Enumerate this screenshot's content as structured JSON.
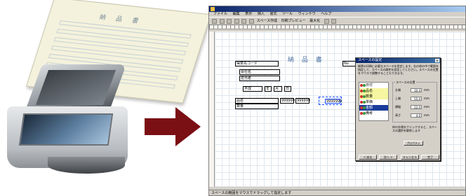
{
  "illustration": {
    "paper_title": "納 品 書",
    "arrow_color": "#7a0f14"
  },
  "app": {
    "menu": [
      "ファイル",
      "編集",
      "表示",
      "挿入",
      "書式",
      "ツール",
      "ウィンドウ",
      "ヘルプ"
    ],
    "toolbar_labels": [
      "スペース作成",
      "印刷プレビュー",
      "最大化"
    ]
  },
  "document": {
    "title": "納 品 書",
    "fields": {
      "customer_code": "得意先コード",
      "company_name": "会社名",
      "person_name": "担当者",
      "heisei": "平成",
      "year": "年",
      "month": "月",
      "date_label": "日",
      "no_label": "No",
      "item_label": "品名",
      "quantity_label": "数量",
      "num1": "999999",
      "num2": "999999",
      "num3": "9999999"
    }
  },
  "dialog": {
    "title": "スペースの設定",
    "description": "帳票の印刷に必要なスペースを設定します。右の枠の中で範囲を指定して、スペースの属性を設定してください。スペースの位置をマウスで調整することもできます。",
    "list_items": [
      {
        "label": "日付",
        "badge_color": "#d03030",
        "state": "normal"
      },
      {
        "label": "品名",
        "badge_color": "#d03030",
        "state": "highlight"
      },
      {
        "label": "数量",
        "badge_color": "#d03030",
        "state": "highlight"
      },
      {
        "label": "単価",
        "badge_color": "#d03030",
        "state": "normal"
      },
      {
        "label": "金額",
        "badge_color": "#d03030",
        "state": "selected"
      },
      {
        "label": "備考",
        "badge_color": "#d03030",
        "state": "normal"
      }
    ],
    "group_label": "スペースの位置",
    "properties": [
      {
        "label": "左端",
        "value": "10.4",
        "unit": "mm"
      },
      {
        "label": "上端",
        "value": "55.0",
        "unit": "mm"
      },
      {
        "label": "横幅",
        "value": "22.0",
        "unit": "mm"
      },
      {
        "label": "高さ",
        "value": "4.0",
        "unit": "mm"
      }
    ],
    "note": "枠の外側をクリックすると、スペースの選択を解除します",
    "button_property": "プロパティ",
    "buttons": [
      "< 戻る",
      "次へ >",
      "キャンセル",
      "完了"
    ]
  },
  "status": {
    "text": "スペースの範囲をマウスでドラッグして指定します"
  }
}
